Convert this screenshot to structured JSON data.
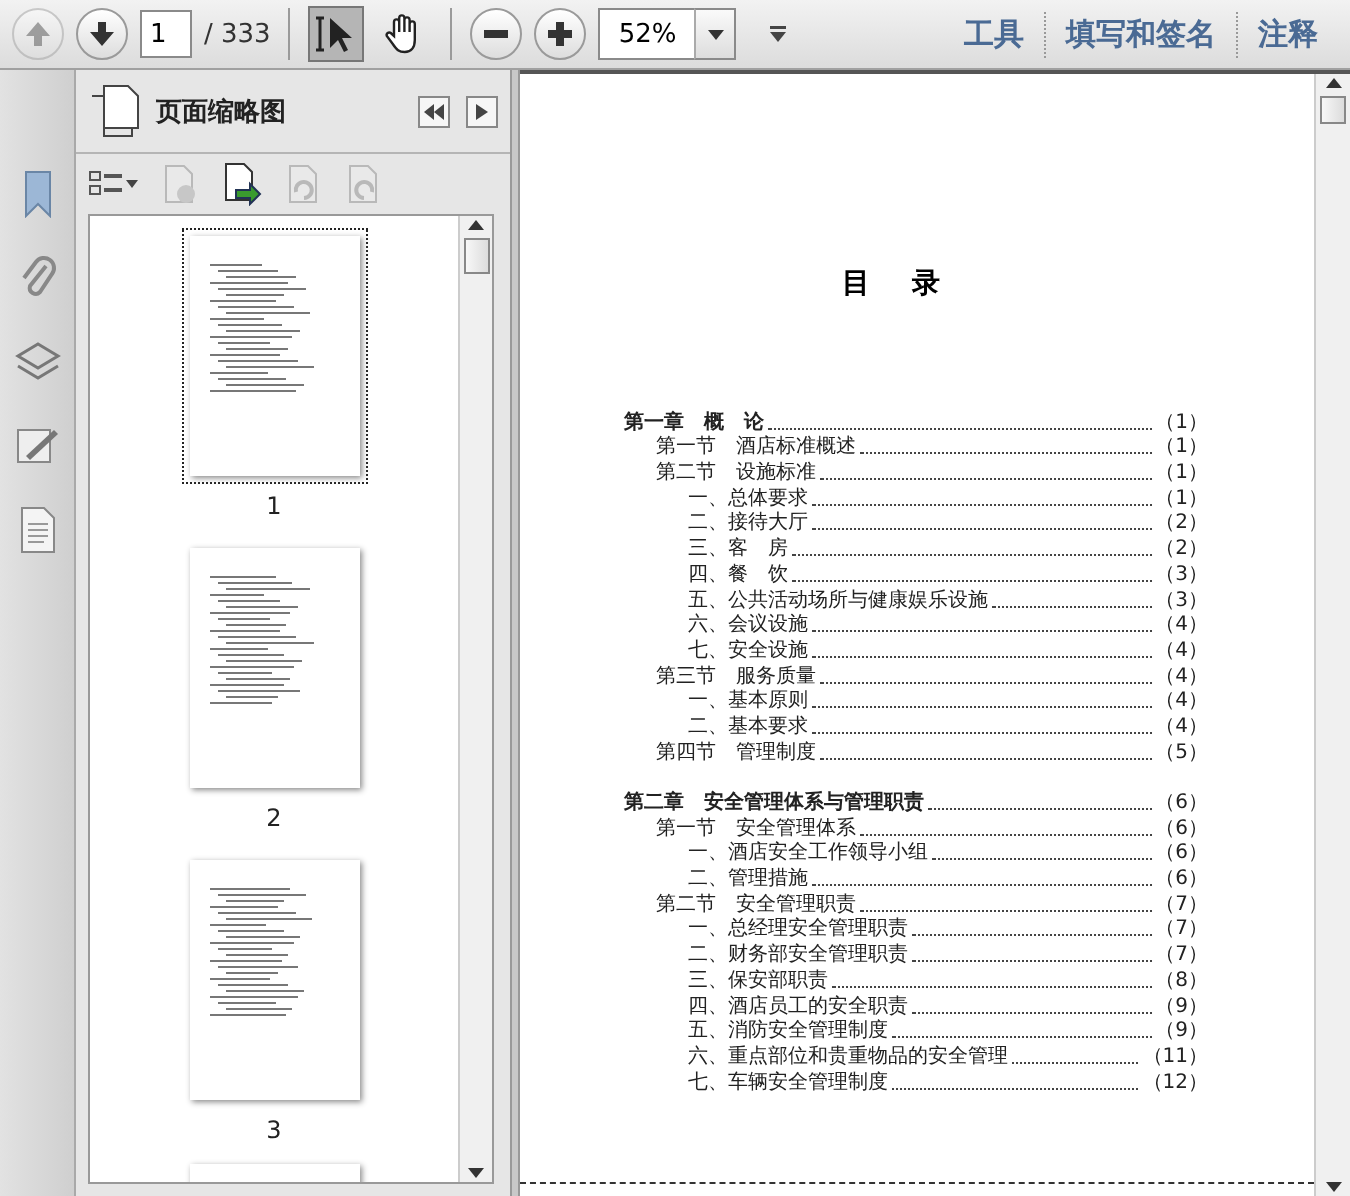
{
  "toolbar": {
    "prev_disabled": true,
    "page_field": {
      "value": "1"
    },
    "page_count": "/ 333",
    "tools": [
      {
        "kind": "select",
        "selected": true
      },
      {
        "kind": "hand",
        "selected": false
      }
    ],
    "zoom_field": {
      "value": "52%"
    },
    "links": [
      "工具",
      "填写和签名",
      "注释"
    ]
  },
  "panel": {
    "title": "页面缩略图",
    "thumbnails": [
      {
        "label": "1",
        "selected": true
      },
      {
        "label": "2",
        "selected": false
      },
      {
        "label": "3",
        "selected": false
      }
    ]
  },
  "document": {
    "title": "目 录",
    "toc": [
      {
        "kind": "chapter",
        "text": "第一章　概　论",
        "page": "（1）"
      },
      {
        "kind": "section",
        "text": "第一节　酒店标准概述",
        "page": "（1）"
      },
      {
        "kind": "section",
        "text": "第二节　设施标准",
        "page": "（1）"
      },
      {
        "kind": "item",
        "text": "一、总体要求",
        "page": "（1）"
      },
      {
        "kind": "item",
        "text": "二、接待大厅",
        "page": "（2）"
      },
      {
        "kind": "item",
        "text": "三、客　房",
        "page": "（2）"
      },
      {
        "kind": "item",
        "text": "四、餐　饮",
        "page": "（3）"
      },
      {
        "kind": "item",
        "text": "五、公共活动场所与健康娱乐设施",
        "page": "（3）"
      },
      {
        "kind": "item",
        "text": "六、会议设施",
        "page": "（4）"
      },
      {
        "kind": "item",
        "text": "七、安全设施",
        "page": "（4）"
      },
      {
        "kind": "section",
        "text": "第三节　服务质量",
        "page": "（4）"
      },
      {
        "kind": "item",
        "text": "一、基本原则",
        "page": "（4）"
      },
      {
        "kind": "item",
        "text": "二、基本要求",
        "page": "（4）"
      },
      {
        "kind": "section",
        "text": "第四节　管理制度",
        "page": "（5）"
      },
      {
        "kind": "gap"
      },
      {
        "kind": "chapter",
        "text": "第二章　安全管理体系与管理职责",
        "page": "（6）"
      },
      {
        "kind": "section",
        "text": "第一节　安全管理体系",
        "page": "（6）"
      },
      {
        "kind": "item",
        "text": "一、酒店安全工作领导小组",
        "page": "（6）"
      },
      {
        "kind": "item",
        "text": "二、管理措施",
        "page": "（6）"
      },
      {
        "kind": "section",
        "text": "第二节　安全管理职责",
        "page": "（7）"
      },
      {
        "kind": "item",
        "text": "一、总经理安全管理职责",
        "page": "（7）"
      },
      {
        "kind": "item",
        "text": "二、财务部安全管理职责",
        "page": "（7）"
      },
      {
        "kind": "item",
        "text": "三、保安部职责",
        "page": "（8）"
      },
      {
        "kind": "item",
        "text": "四、酒店员工的安全职责",
        "page": "（9）"
      },
      {
        "kind": "item",
        "text": "五、消防安全管理制度",
        "page": "（9）"
      },
      {
        "kind": "item",
        "text": "六、重点部位和贵重物品的安全管理",
        "page": "（11）"
      },
      {
        "kind": "item",
        "text": "七、车辆安全管理制度",
        "page": "（12）"
      }
    ]
  }
}
